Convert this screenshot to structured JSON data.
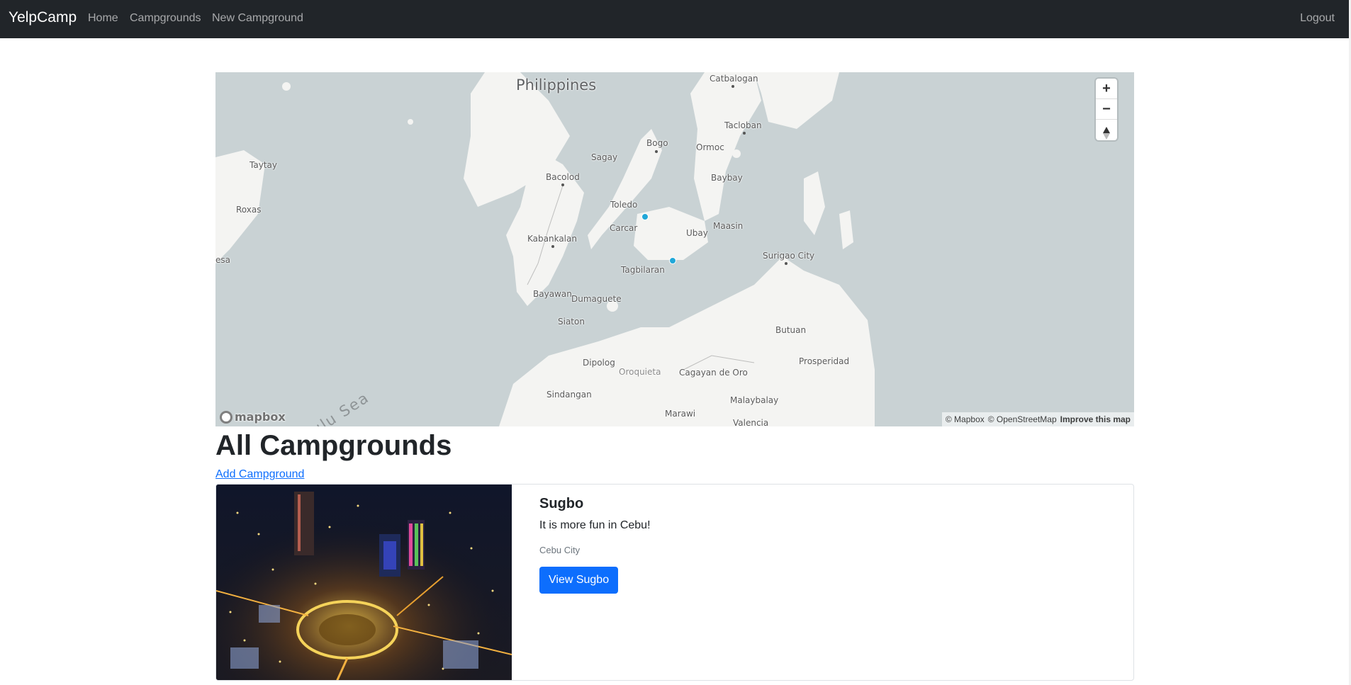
{
  "nav": {
    "brand": "YelpCamp",
    "home": "Home",
    "campgrounds": "Campgrounds",
    "new_campground": "New Campground",
    "logout": "Logout"
  },
  "map": {
    "region_label": "Philippines",
    "sea_label": "ulu Sea",
    "places": {
      "catbalogan": "Catbalogan",
      "tacloban": "Tacloban",
      "ormoc": "Ormoc",
      "bogo": "Bogo",
      "sagay": "Sagay",
      "bacolod": "Bacolod",
      "baybay": "Baybay",
      "toledo": "Toledo",
      "carcar": "Carcar",
      "ubay": "Ubay",
      "maasin": "Maasin",
      "kabankalan": "Kabankalan",
      "tagbilaran": "Tagbilaran",
      "surigao": "Surigao City",
      "bayawan": "Bayawan",
      "dumaguete": "Dumaguete",
      "siaton": "Siaton",
      "butuan": "Butuan",
      "dipolog": "Dipolog",
      "oroquieta": "Oroquieta",
      "cagayan": "Cagayan de Oro",
      "prosperidad": "Prosperidad",
      "sindangan": "Sindangan",
      "malaybalay": "Malaybalay",
      "marawi": "Marawi",
      "valencia": "Valencia",
      "taytay": "Taytay",
      "roxas": "Roxas",
      "esa": "esa"
    },
    "controls": {
      "zoom_in": "+",
      "zoom_out": "−"
    },
    "logo_text": "mapbox",
    "attribution": {
      "mapbox": "© Mapbox",
      "osm": "© OpenStreetMap",
      "improve": "Improve this map"
    }
  },
  "main": {
    "title": "All Campgrounds",
    "add_link": "Add Campground"
  },
  "campgrounds": [
    {
      "title": "Sugbo",
      "description": "It is more fun in Cebu!",
      "location": "Cebu City",
      "button": "View Sugbo"
    }
  ],
  "colors": {
    "navbar": "#212529",
    "primary": "#0d6efd",
    "map_water": "#c9d2d4",
    "marker": "#20a7d8"
  }
}
